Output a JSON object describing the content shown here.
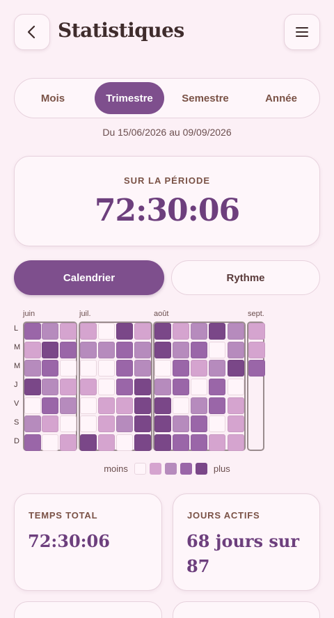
{
  "header": {
    "title": "Statistiques",
    "back_icon": "chevron-left-icon",
    "menu_icon": "hamburger-menu-icon"
  },
  "period_tabs": {
    "items": [
      "Mois",
      "Trimestre",
      "Semestre",
      "Année"
    ],
    "selected": "Trimestre"
  },
  "date_range": "Du 15/06/2026 au 09/09/2026",
  "period_summary": {
    "label": "SUR LA PÉRIODE",
    "value": "72:30:06"
  },
  "view_toggle": {
    "calendar_label": "Calendrier",
    "rhythm_label": "Rythme",
    "selected": "Calendrier"
  },
  "calendar": {
    "months": [
      "juin",
      "juil.",
      "août",
      "sept."
    ],
    "day_labels": [
      "L",
      "M",
      "M",
      "J",
      "V",
      "S",
      "D"
    ],
    "weeks": [
      [
        3,
        1,
        2,
        4,
        0,
        2,
        3
      ],
      [
        2,
        4,
        3,
        2,
        3,
        1,
        0
      ],
      [
        1,
        3,
        0,
        1,
        2,
        0,
        1
      ],
      [
        1,
        2,
        0,
        1,
        0,
        0,
        4
      ],
      [
        0,
        2,
        0,
        0,
        1,
        1,
        1
      ],
      [
        4,
        3,
        3,
        3,
        1,
        2,
        0
      ],
      [
        1,
        2,
        2,
        4,
        4,
        4,
        4
      ],
      [
        4,
        4,
        0,
        2,
        4,
        4,
        4
      ],
      [
        1,
        2,
        3,
        3,
        0,
        2,
        3
      ],
      [
        2,
        3,
        1,
        0,
        2,
        3,
        3
      ],
      [
        4,
        0,
        2,
        3,
        3,
        0,
        1
      ],
      [
        2,
        2,
        4,
        0,
        1,
        1,
        1
      ],
      [
        1,
        1,
        3
      ]
    ],
    "legend": {
      "less_label": "moins",
      "more_label": "plus"
    },
    "colors": [
      "#fff5fa",
      "#d5a4cf",
      "#b68bbd",
      "#9a66a8",
      "#7a4788"
    ]
  },
  "stats": {
    "total_time_label": "TEMPS TOTAL",
    "total_time_value": "72:30:06",
    "active_days_label": "JOURS ACTIFS",
    "active_days_value": "68 jours sur 87"
  }
}
